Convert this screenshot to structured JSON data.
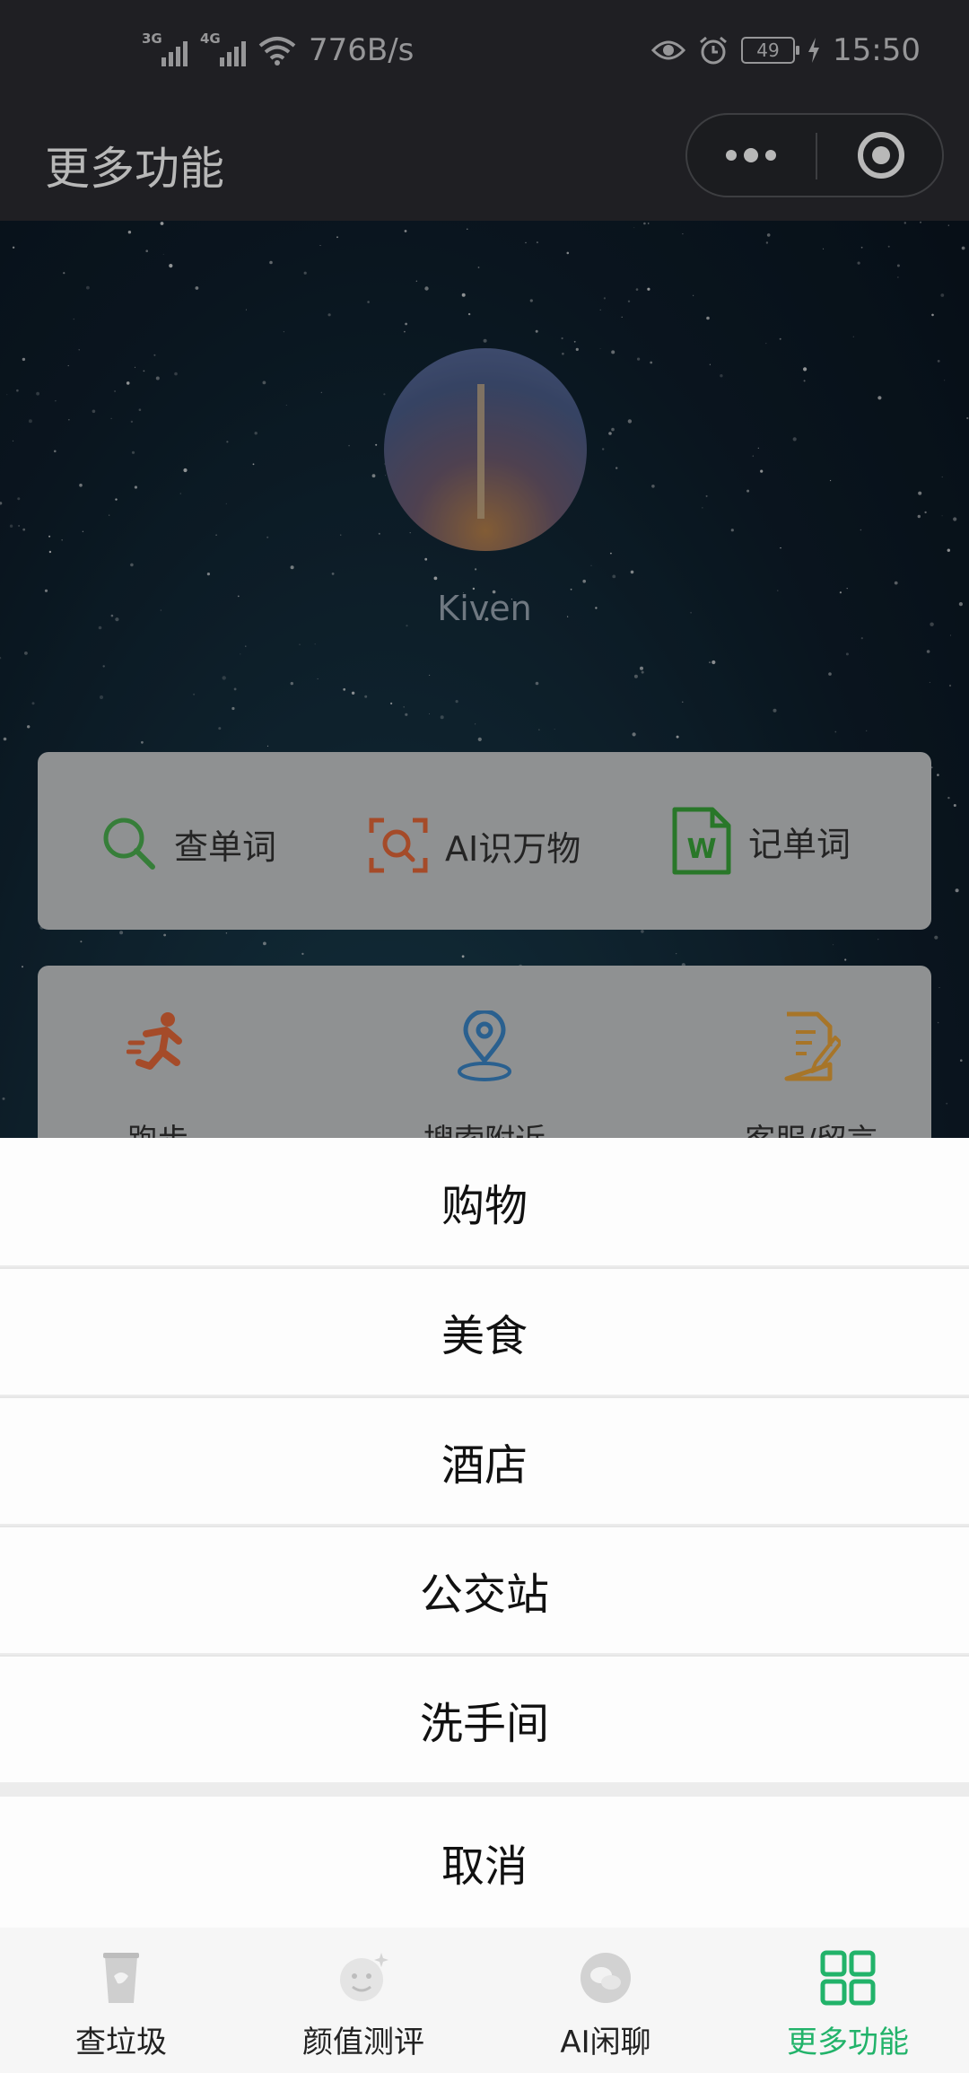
{
  "status_bar": {
    "net1": "3G",
    "net2": "4G",
    "speed": "776B/s",
    "battery": "49",
    "time": "15:50"
  },
  "header": {
    "title": "更多功能"
  },
  "profile": {
    "username": "Kiven"
  },
  "tools_row1": [
    {
      "label": "查单词",
      "icon": "search-icon",
      "color": "#4caf50"
    },
    {
      "label": "AI识万物",
      "icon": "scan-icon",
      "color": "#e5683a"
    },
    {
      "label": "记单词",
      "icon": "word-doc-icon",
      "color": "#3aa53a"
    }
  ],
  "tools_row2": [
    {
      "label": "跑步",
      "icon": "running-icon",
      "color": "#e5683a"
    },
    {
      "label": "搜索附近",
      "icon": "location-pin-icon",
      "color": "#3b86c6"
    },
    {
      "label": "客服/留言",
      "icon": "edit-note-icon",
      "color": "#e8a23a"
    }
  ],
  "action_sheet": {
    "items": [
      "购物",
      "美食",
      "酒店",
      "公交站",
      "洗手间"
    ],
    "cancel": "取消"
  },
  "tabbar": {
    "tabs": [
      {
        "label": "查垃圾",
        "icon": "trash-bin-icon"
      },
      {
        "label": "颜值测评",
        "icon": "face-icon"
      },
      {
        "label": "AI闲聊",
        "icon": "chat-icon"
      },
      {
        "label": "更多功能",
        "icon": "grid-icon"
      }
    ],
    "active_color": "#22b36a"
  }
}
